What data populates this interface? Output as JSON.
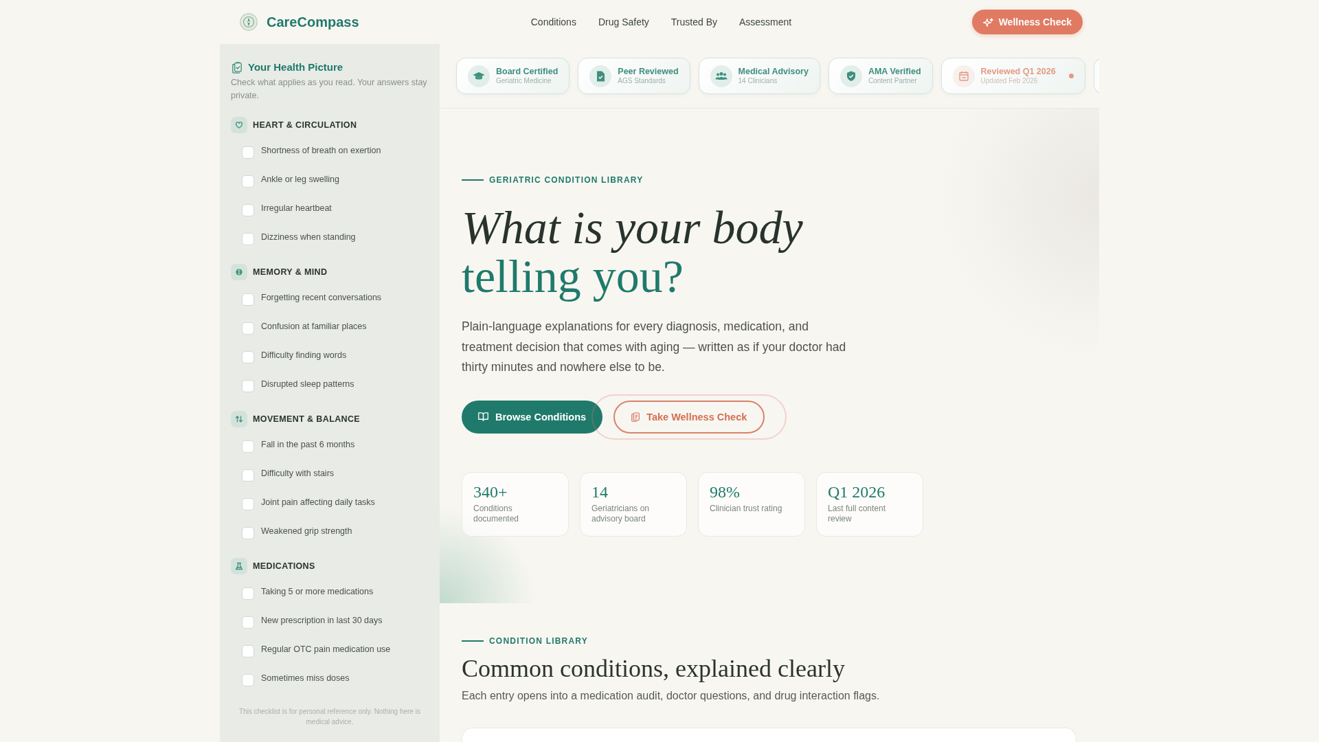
{
  "header": {
    "brand": "CareCompass",
    "nav": [
      "Conditions",
      "Drug Safety",
      "Trusted By",
      "Assessment"
    ],
    "cta": "Wellness Check"
  },
  "sidebar": {
    "title": "Your Health Picture",
    "description": "Check what applies as you read. Your answers stay private.",
    "sections": [
      {
        "kind": "heart",
        "title": "HEART & CIRCULATION",
        "items": [
          {
            "label": "Shortness of breath on exertion",
            "checked": false
          },
          {
            "label": "Ankle or leg swelling",
            "checked": false
          },
          {
            "label": "Irregular heartbeat",
            "checked": false
          },
          {
            "label": "Dizziness when standing",
            "checked": false
          }
        ]
      },
      {
        "kind": "mind",
        "title": "MEMORY & MIND",
        "items": [
          {
            "label": "Forgetting recent conversations",
            "checked": false
          },
          {
            "label": "Confusion at familiar places",
            "checked": false
          },
          {
            "label": "Difficulty finding words",
            "checked": false
          },
          {
            "label": "Disrupted sleep patterns",
            "checked": false
          }
        ]
      },
      {
        "kind": "movement",
        "title": "MOVEMENT & BALANCE",
        "items": [
          {
            "label": "Fall in the past 6 months",
            "checked": false
          },
          {
            "label": "Difficulty with stairs",
            "checked": false
          },
          {
            "label": "Joint pain affecting daily tasks",
            "checked": false
          },
          {
            "label": "Weakened grip strength",
            "checked": false
          }
        ]
      },
      {
        "kind": "medication",
        "title": "MEDICATIONS",
        "items": [
          {
            "label": "Taking 5 or more medications",
            "checked": false
          },
          {
            "label": "New prescription in last 30 days",
            "checked": false
          },
          {
            "label": "Regular OTC pain medication use",
            "checked": false
          },
          {
            "label": "Sometimes miss doses",
            "checked": false
          }
        ]
      }
    ],
    "footnote": "This checklist is for personal reference only. Nothing here is medical advice."
  },
  "badges": [
    {
      "kind": "cap",
      "title": "Board Certified",
      "subtitle": "Geriatric Medicine",
      "color": "#3f8f7d",
      "dot": false
    },
    {
      "kind": "document",
      "title": "Peer Reviewed",
      "subtitle": "AGS Standards",
      "color": "#3f8f7d",
      "dot": false
    },
    {
      "kind": "people",
      "title": "Medical Advisory",
      "subtitle": "14 Clinicians",
      "color": "#3f8f7d",
      "dot": false
    },
    {
      "kind": "shield",
      "title": "AMA Verified",
      "subtitle": "Content Partner",
      "color": "#3f8f7d",
      "dot": false
    },
    {
      "kind": "calendar",
      "title": "Reviewed Q1 2026",
      "subtitle": "Updated Feb 2026",
      "color": "#e39a85",
      "dot": true
    }
  ],
  "hero": {
    "eyebrow": "GERIATRIC CONDITION LIBRARY",
    "headline": [
      {
        "kind": "italic",
        "text": "What is your body"
      },
      {
        "kind": "accent",
        "text": "telling you?"
      }
    ],
    "lead": "Plain-language explanations for every diagnosis, medication, and treatment decision that comes with aging — written as if your doctor had thirty minutes and nowhere else to be.",
    "buttons": [
      {
        "kind": "primary",
        "label": "Browse Conditions"
      },
      {
        "kind": "outline",
        "label": "Take Wellness Check"
      }
    ],
    "stats": [
      {
        "value": "340+",
        "label": "Conditions documented"
      },
      {
        "value": "14",
        "label": "Geriatricians on advisory board"
      },
      {
        "value": "98%",
        "label": "Clinician trust rating"
      },
      {
        "value": "Q1 2026",
        "label": "Last full content review"
      }
    ]
  },
  "library": {
    "eyebrow": "CONDITION LIBRARY",
    "title": "Common conditions, explained clearly",
    "subtitle": "Each entry opens into a medication audit, doctor questions, and drug interaction flags."
  }
}
